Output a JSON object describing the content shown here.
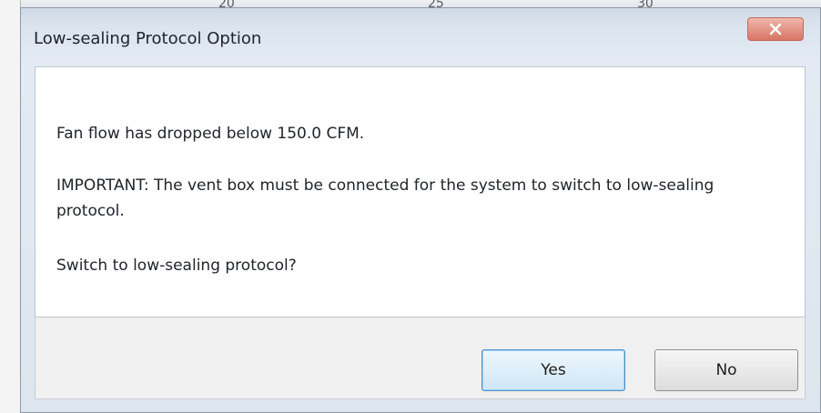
{
  "background": {
    "ticks": [
      "20",
      "25",
      "30"
    ]
  },
  "dialog": {
    "title": "Low-sealing Protocol Option",
    "close_icon": "close-icon",
    "close_label": "x",
    "messages": [
      "Fan flow has dropped below 150.0 CFM.",
      "IMPORTANT: The vent box must be connected for the system to switch to low-sealing protocol.",
      "Switch to low-sealing protocol?"
    ],
    "buttons": {
      "yes": "Yes",
      "no": "No"
    }
  },
  "colors": {
    "close_button": "#d87565",
    "default_button_border": "#4a90c9"
  }
}
